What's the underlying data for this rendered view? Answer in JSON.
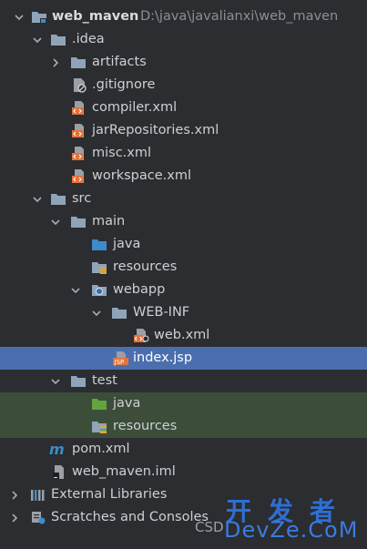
{
  "tree": {
    "root": {
      "name": "web_maven",
      "path": "D:\\java\\javalianxi\\web_maven"
    },
    "idea": {
      "name": ".idea"
    },
    "artifacts": {
      "name": "artifacts"
    },
    "gitignore": {
      "name": ".gitignore"
    },
    "compiler": {
      "name": "compiler.xml"
    },
    "jarRepos": {
      "name": "jarRepositories.xml"
    },
    "misc": {
      "name": "misc.xml"
    },
    "workspace": {
      "name": "workspace.xml"
    },
    "src": {
      "name": "src"
    },
    "main": {
      "name": "main"
    },
    "main_java": {
      "name": "java"
    },
    "main_resources": {
      "name": "resources"
    },
    "webapp": {
      "name": "webapp"
    },
    "webinf": {
      "name": "WEB-INF"
    },
    "webxml": {
      "name": "web.xml"
    },
    "indexjsp": {
      "name": "index.jsp"
    },
    "test": {
      "name": "test"
    },
    "test_java": {
      "name": "java"
    },
    "test_resources": {
      "name": "resources"
    },
    "pom": {
      "name": "pom.xml"
    },
    "iml": {
      "name": "web_maven.iml"
    },
    "extlibs": {
      "name": "External Libraries"
    },
    "scratches": {
      "name": "Scratches and Consoles"
    }
  },
  "watermark": {
    "line1": "开发者",
    "line2": "DevZe.CoM",
    "csdn": "CSD"
  },
  "colors": {
    "selection": "#4b6eaf",
    "test_highlight": "#3c4d3a",
    "folder": "#8fa4b8",
    "source_folder": "#3d8cc9",
    "test_folder": "#62a43e",
    "xml": "#e2733a"
  }
}
